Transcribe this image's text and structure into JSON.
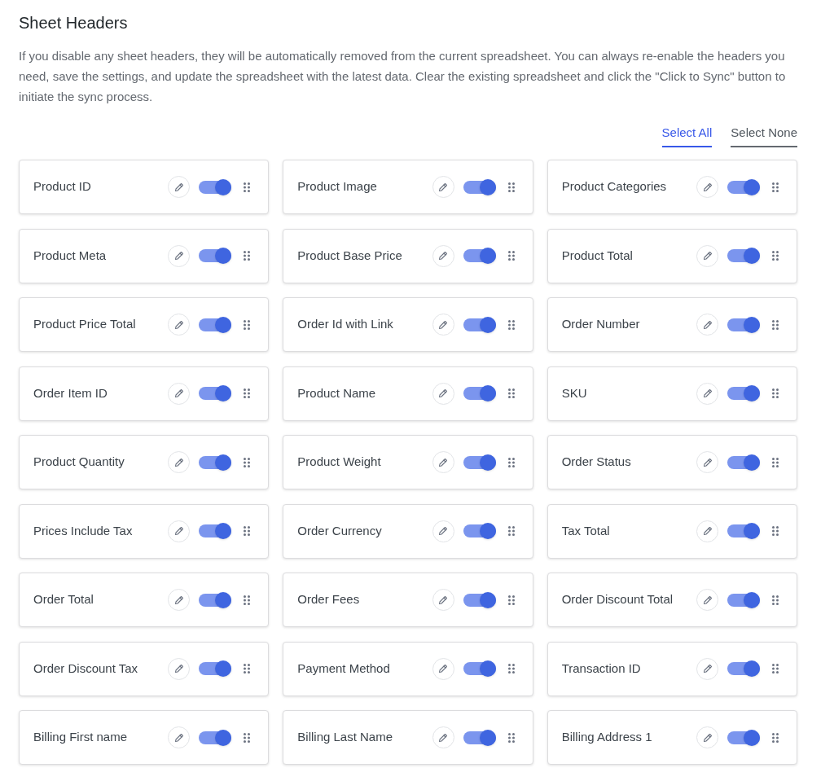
{
  "title": "Sheet Headers",
  "description": "If you disable any sheet headers, they will be automatically removed from the current spreadsheet. You can always re-enable the headers you need, save the settings, and update the spreadsheet with the latest data. Clear the existing spreadsheet and click the \"Click to Sync\" button to initiate the sync process.",
  "select_links": [
    {
      "label": "Select All",
      "selected": true
    },
    {
      "label": "Select None",
      "selected": false
    }
  ],
  "headers": [
    {
      "label": "Product ID",
      "on": true
    },
    {
      "label": "Product Image",
      "on": true
    },
    {
      "label": "Product Categories",
      "on": true
    },
    {
      "label": "Product Meta",
      "on": true
    },
    {
      "label": "Product Base Price",
      "on": true
    },
    {
      "label": "Product Total",
      "on": true
    },
    {
      "label": "Product Price Total",
      "on": true
    },
    {
      "label": "Order Id with Link",
      "on": true
    },
    {
      "label": "Order Number",
      "on": true
    },
    {
      "label": "Order Item ID",
      "on": true
    },
    {
      "label": "Product Name",
      "on": true
    },
    {
      "label": "SKU",
      "on": true
    },
    {
      "label": "Product Quantity",
      "on": true
    },
    {
      "label": "Product Weight",
      "on": true
    },
    {
      "label": "Order Status",
      "on": true
    },
    {
      "label": "Prices Include Tax",
      "on": true
    },
    {
      "label": "Order Currency",
      "on": true
    },
    {
      "label": "Tax Total",
      "on": true
    },
    {
      "label": "Order Total",
      "on": true
    },
    {
      "label": "Order Fees",
      "on": true
    },
    {
      "label": "Order Discount Total",
      "on": true
    },
    {
      "label": "Order Discount Tax",
      "on": true
    },
    {
      "label": "Payment Method",
      "on": true
    },
    {
      "label": "Transaction ID",
      "on": true
    },
    {
      "label": "Billing First name",
      "on": true
    },
    {
      "label": "Billing Last Name",
      "on": true
    },
    {
      "label": "Billing Address 1",
      "on": true
    }
  ]
}
